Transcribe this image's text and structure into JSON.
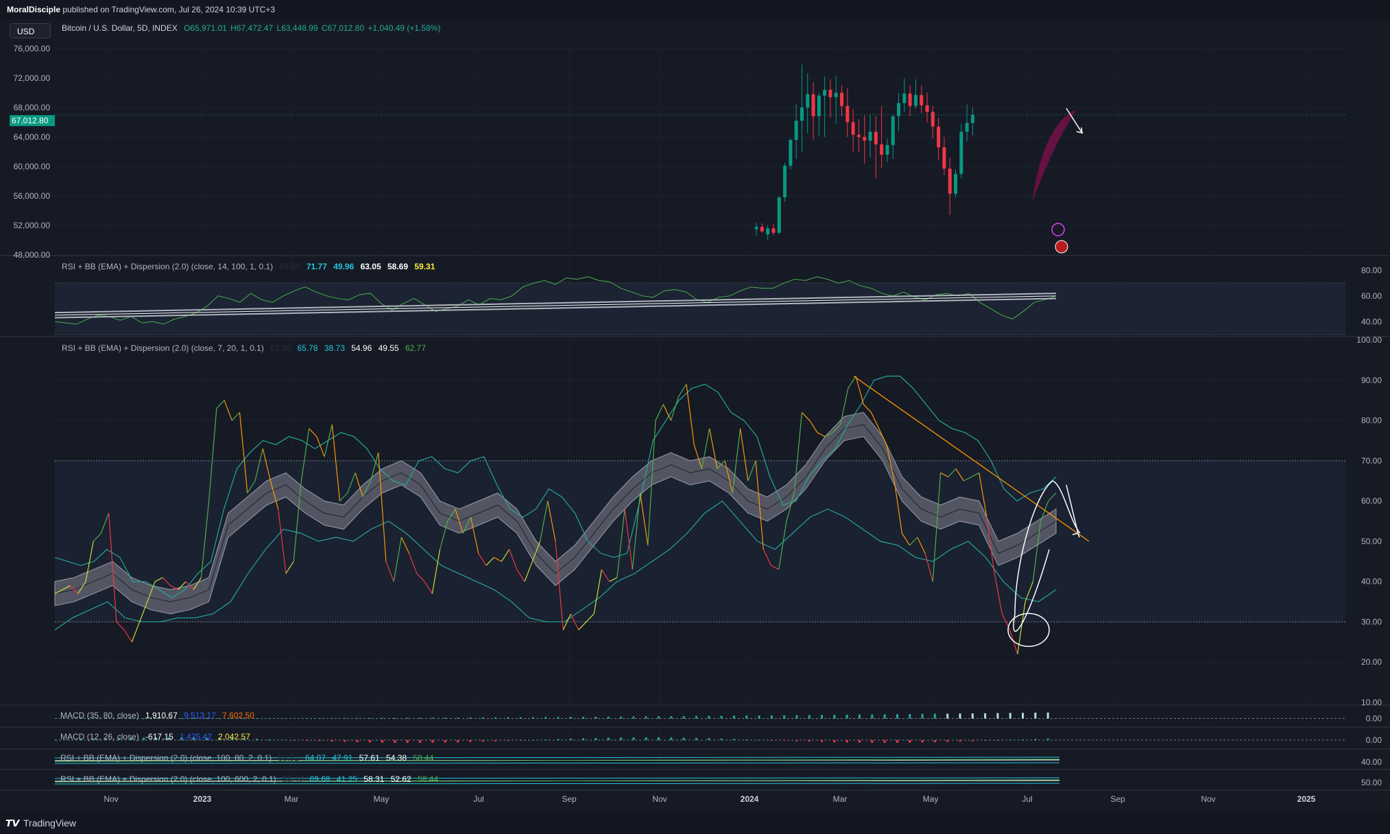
{
  "publisher_line": {
    "user": "MoralDisciple",
    "rest": "published on TradingView.com, Jul 26, 2024 10:39 UTC+3"
  },
  "currency_button": "USD",
  "symbol": {
    "name": "Bitcoin / U.S. Dollar, 5D, INDEX",
    "open": "O65,971.01",
    "high": "H67,472.47",
    "low": "L63,448.99",
    "close": "C67,012.80",
    "change": "+1,040.49 (+1.58%)"
  },
  "last_price_tag": "67,012.80",
  "indicators": {
    "rsi1": {
      "label": "RSI + BB (EMA) + Dispersion (2.0) (close, 14, 100, 1, 0.1)",
      "v0": "60.87",
      "v1": "71.77",
      "v2": "49.96",
      "v3": "63.05",
      "v4": "58.69",
      "v5": "59.31"
    },
    "rsi2": {
      "label": "RSI + BB (EMA) + Dispersion (2.0) (close, 7, 20, 1, 0.1)",
      "v0": "52.26",
      "v1": "65.78",
      "v2": "38.73",
      "v3": "54.96",
      "v4": "49.55",
      "v5": "62.77"
    },
    "macd1": {
      "label": "MACD (35, 80, close)",
      "v1": "1,910.67",
      "v2": "9,513.17",
      "v3": "7,602.50"
    },
    "macd2": {
      "label": "MACD (12, 26, close)",
      "v1": "-617.15",
      "v2": "1,425.42",
      "v3": "2,042.57"
    },
    "rsi3": {
      "label": "RSI + BB (EMA) + Dispersion (2.0) (close, 100, 80, 2, 0.1)",
      "v0": "55.51",
      "v1": "64.07",
      "v2": "47.91",
      "v3": "57.61",
      "v4": "54.38",
      "v5": "58.44"
    },
    "rsi4": {
      "label": "RSI + BB (EMA) + Dispersion (2.0) (close, 100, 600, 2, 0.1)",
      "v0": "55.47",
      "v1": "69.68",
      "v2": "41.25",
      "v3": "58.31",
      "v4": "52.62",
      "v5": "58.44"
    }
  },
  "branding": "TradingView",
  "colors": {
    "up": "#089981",
    "down": "#f23645",
    "rsi_green": "#4caf50",
    "band_cyan": "#26c6da",
    "trend_orange": "#ff9800",
    "bg": "#161a25"
  },
  "chart_data": [
    {
      "type": "candlestick",
      "title": "Bitcoin / U.S. Dollar, 5D, INDEX",
      "ylim": [
        48000,
        77000
      ],
      "y_ticks": [
        "76,000.00",
        "72,000.00",
        "68,000.00",
        "64,000.00",
        "60,000.00",
        "56,000.00",
        "52,000.00",
        "48,000.00"
      ],
      "x_ticks": [
        "Nov",
        "2023",
        "Mar",
        "May",
        "Jul",
        "Sep",
        "Nov",
        "2024",
        "Mar",
        "May",
        "Jul",
        "Sep",
        "Nov",
        "2025"
      ],
      "x_ticks_bold": [
        "2023",
        "2024",
        "2025"
      ],
      "last": 67012.8,
      "candles": [
        [
          51500,
          52400,
          50600,
          51800
        ],
        [
          51800,
          52300,
          51000,
          51200
        ],
        [
          50800,
          52000,
          50000,
          51600
        ],
        [
          51600,
          52200,
          50700,
          51000
        ],
        [
          51000,
          56000,
          50800,
          55800
        ],
        [
          55800,
          60500,
          55200,
          60100
        ],
        [
          60100,
          63800,
          59600,
          63600
        ],
        [
          63600,
          68400,
          61000,
          66200
        ],
        [
          66200,
          73800,
          62000,
          68000
        ],
        [
          68000,
          72600,
          64500,
          69800
        ],
        [
          69800,
          71400,
          63600,
          66800
        ],
        [
          66800,
          70000,
          64200,
          69600
        ],
        [
          69600,
          72200,
          64000,
          70400
        ],
        [
          70400,
          71800,
          66600,
          69400
        ],
        [
          69400,
          72300,
          65800,
          70000
        ],
        [
          70000,
          71000,
          66800,
          68200
        ],
        [
          68200,
          70600,
          64000,
          66000
        ],
        [
          66000,
          67800,
          62000,
          64300
        ],
        [
          64300,
          66400,
          61900,
          64000
        ],
        [
          64000,
          66900,
          60400,
          63500
        ],
        [
          63500,
          67000,
          61200,
          64700
        ],
        [
          64700,
          66800,
          58400,
          63000
        ],
        [
          63000,
          68200,
          59800,
          61600
        ],
        [
          61600,
          63800,
          60600,
          62900
        ],
        [
          62900,
          67000,
          61000,
          66800
        ],
        [
          66800,
          70000,
          64800,
          68600
        ],
        [
          68600,
          71900,
          67400,
          69900
        ],
        [
          69900,
          71000,
          66800,
          68200
        ],
        [
          68200,
          71800,
          67800,
          69700
        ],
        [
          69700,
          71000,
          67200,
          68300
        ],
        [
          68300,
          70000,
          66000,
          67400
        ],
        [
          67400,
          68200,
          63800,
          65400
        ],
        [
          65400,
          66600,
          60900,
          62600
        ],
        [
          62600,
          64000,
          58800,
          59700
        ],
        [
          59700,
          61200,
          53400,
          56300
        ],
        [
          56300,
          59600,
          55800,
          59000
        ],
        [
          59000,
          65800,
          58400,
          64700
        ],
        [
          64700,
          68400,
          63400,
          65900
        ],
        [
          65900,
          68000,
          64200,
          67000
        ]
      ]
    },
    {
      "type": "line",
      "title": "RSI + BB (EMA) + Dispersion (2.0) (close, 14, 100, 1, 0.1)",
      "ylim": [
        30,
        85
      ],
      "y_ticks": [
        "80.00",
        "60.00",
        "40.00"
      ],
      "series": [
        {
          "values": [
            40,
            39,
            38,
            42,
            45,
            44,
            41,
            44,
            39,
            40,
            38,
            42,
            44,
            47,
            52,
            60,
            58,
            55,
            62,
            57,
            55,
            60,
            64,
            67,
            63,
            60,
            58,
            57,
            61,
            62,
            54,
            49,
            54,
            58,
            53,
            48,
            50,
            52,
            57,
            53,
            58,
            57,
            60,
            67,
            70,
            72,
            69,
            74,
            73,
            75,
            72,
            71,
            66,
            63,
            60,
            59,
            64,
            65,
            63,
            57,
            55,
            59,
            60,
            64,
            67,
            66,
            66,
            70,
            73,
            72,
            75,
            73,
            70,
            72,
            68,
            66,
            62,
            60,
            63,
            59,
            57,
            61,
            62,
            60,
            62,
            55,
            50,
            45,
            42,
            48,
            55,
            57,
            60
          ]
        }
      ]
    },
    {
      "type": "line",
      "title": "RSI + BB (EMA) + Dispersion (2.0) (close, 7, 20, 1, 0.1)",
      "ylim": [
        10,
        100
      ],
      "y_ticks": [
        "100.00",
        "90.00",
        "80.00",
        "70.00",
        "60.00",
        "50.00",
        "40.00",
        "30.00",
        "20.00",
        "10.00"
      ],
      "series": [
        {
          "values": [
            37,
            38,
            39,
            37,
            40,
            50,
            52,
            57,
            30,
            28,
            25,
            30,
            35,
            40,
            41,
            39,
            38,
            40,
            38,
            41,
            60,
            83,
            85,
            80,
            82,
            62,
            65,
            73,
            65,
            58,
            42,
            45,
            65,
            78,
            76,
            71,
            79,
            60,
            62,
            67,
            61,
            65,
            72,
            45,
            40,
            51,
            47,
            42,
            40,
            37,
            48,
            55,
            58,
            52,
            56,
            47,
            44,
            46,
            45,
            48,
            43,
            40,
            45,
            50,
            60,
            50,
            28,
            32,
            28,
            30,
            32,
            43,
            40,
            41,
            58,
            43,
            62,
            49,
            80,
            84,
            80,
            86,
            89,
            74,
            68,
            78,
            68,
            70,
            62,
            78,
            65,
            70,
            48,
            44,
            43,
            55,
            62,
            82,
            80,
            77,
            76,
            77,
            79,
            88,
            91,
            84,
            82,
            78,
            74,
            65,
            52,
            49,
            51,
            47,
            40,
            67,
            66,
            68,
            65,
            66,
            67,
            56,
            42,
            32,
            28,
            22,
            35,
            40,
            55,
            60,
            62
          ]
        },
        {
          "values": [
            46,
            45,
            44,
            45,
            48,
            46,
            40,
            40,
            38,
            36,
            38,
            42,
            45,
            58,
            68,
            72,
            75,
            74,
            76,
            75,
            73,
            75,
            77,
            76,
            73,
            68,
            65,
            64,
            70,
            71,
            68,
            67,
            70,
            71,
            64,
            58,
            56,
            58,
            63,
            61,
            57,
            50,
            47,
            46,
            47,
            60,
            75,
            80,
            85,
            88,
            89,
            87,
            82,
            80,
            76,
            66,
            59,
            60,
            66,
            70,
            73,
            79,
            84,
            90,
            91,
            91,
            88,
            84,
            80,
            78,
            77,
            75,
            70,
            63,
            60,
            62,
            63,
            66
          ]
        },
        {
          "values": [
            28,
            31,
            33,
            35,
            31,
            30,
            30,
            31,
            31,
            32,
            35,
            42,
            48,
            53,
            52,
            50,
            51,
            50,
            53,
            55,
            52,
            48,
            44,
            42,
            40,
            38,
            35,
            31,
            30,
            30,
            33,
            36,
            40,
            42,
            45,
            48,
            52,
            57,
            60,
            55,
            50,
            48,
            52,
            56,
            58,
            56,
            53,
            50,
            49,
            46,
            45,
            48,
            50,
            46,
            40,
            36,
            35,
            38
          ]
        }
      ]
    },
    {
      "type": "bar",
      "title": "MACD (35, 80, close)",
      "y_ticks": [
        "0.00"
      ]
    },
    {
      "type": "bar",
      "title": "MACD (12, 26, close)",
      "y_ticks": [
        "0.00"
      ]
    },
    {
      "type": "line",
      "title": "RSI + BB (EMA) + Dispersion (2.0) (close, 100, 80, 2, 0.1)",
      "y_ticks": [
        "40.00"
      ]
    },
    {
      "type": "line",
      "title": "RSI + BB (EMA) + Dispersion (2.0) (close, 100, 600, 2, 0.1)",
      "y_ticks": [
        "50.00"
      ]
    }
  ]
}
